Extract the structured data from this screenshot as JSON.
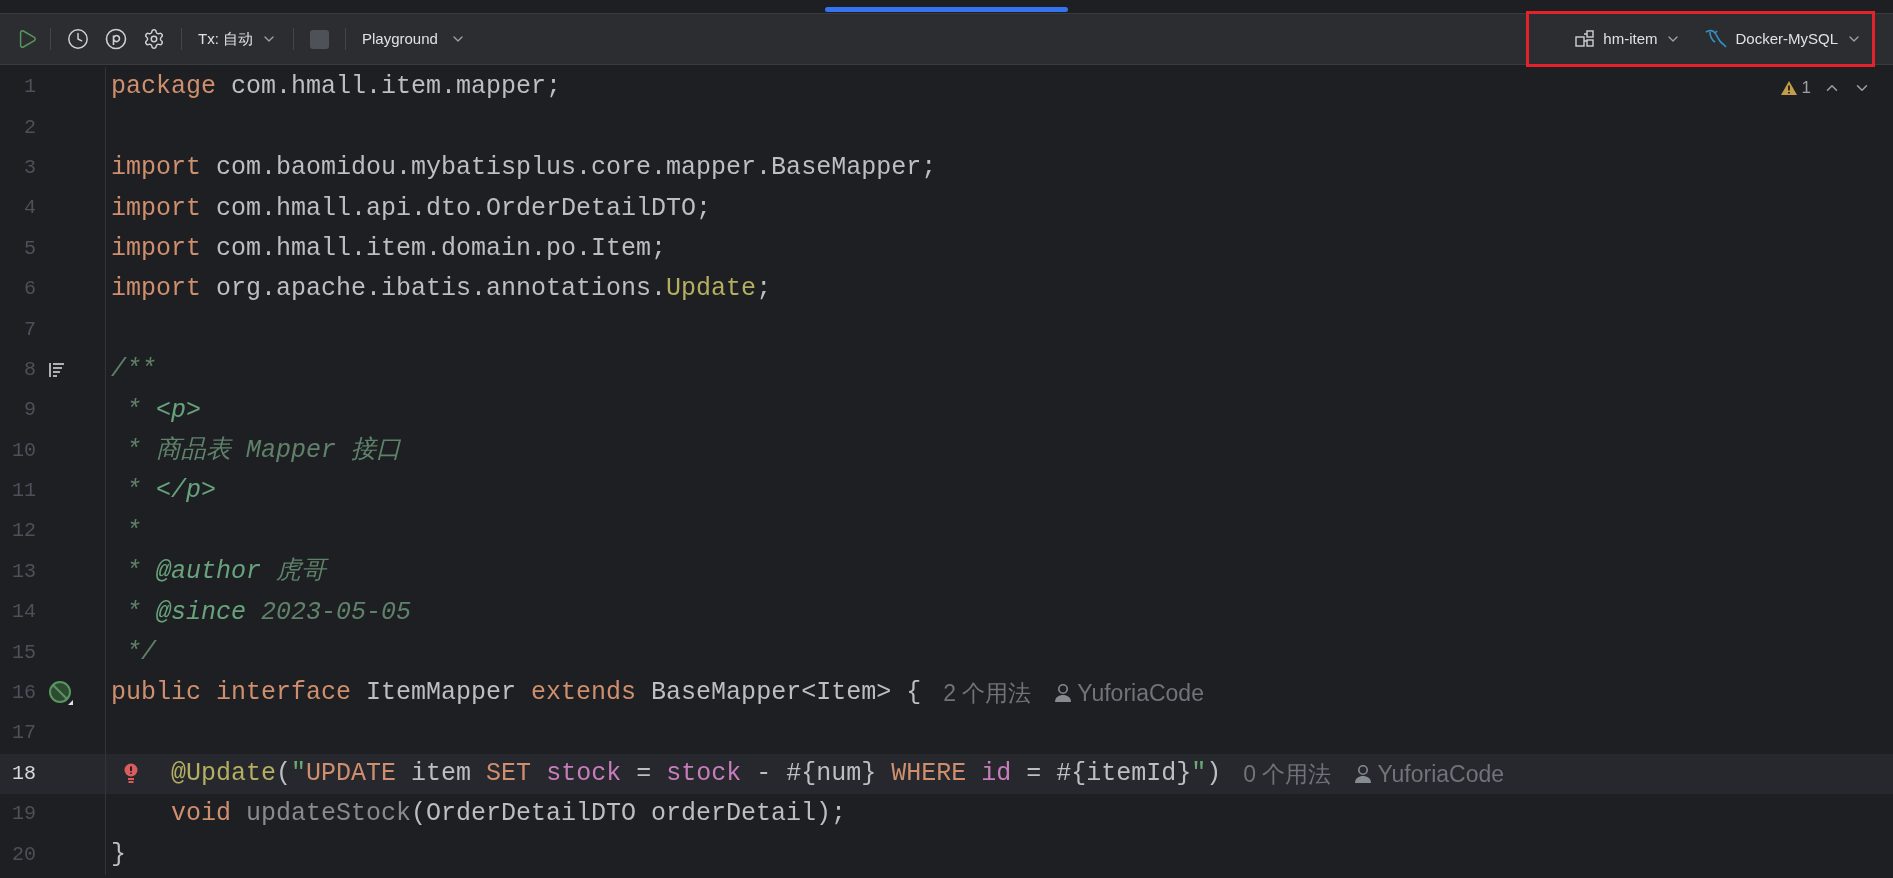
{
  "toolbar": {
    "tx_mode": "Tx: 自动",
    "session": "Playground",
    "schema": "hm-item",
    "datasource": "Docker-MySQL",
    "highlighted": true
  },
  "editor": {
    "problems": "1",
    "lines": [
      {
        "number": "1",
        "kind": "plain",
        "current": false,
        "tokens": [
          {
            "kind": "kw",
            "text": "package "
          },
          {
            "kind": "text",
            "text": "com.hmall.item.mapper;"
          }
        ]
      },
      {
        "number": "2",
        "kind": "plain",
        "current": false
      },
      {
        "number": "3",
        "kind": "plain",
        "current": false,
        "tokens": [
          {
            "kind": "kw",
            "text": "import "
          },
          {
            "kind": "text",
            "text": "com.baomidou.mybatisplus.core.mapper.BaseMapper;"
          }
        ]
      },
      {
        "number": "4",
        "kind": "plain",
        "current": false,
        "tokens": [
          {
            "kind": "kw",
            "text": "import "
          },
          {
            "kind": "text",
            "text": "com.hmall.api.dto.OrderDetailDTO;"
          }
        ]
      },
      {
        "number": "5",
        "kind": "plain",
        "current": false,
        "tokens": [
          {
            "kind": "kw",
            "text": "import "
          },
          {
            "kind": "text",
            "text": "com.hmall.item.domain.po.Item;"
          }
        ]
      },
      {
        "number": "6",
        "kind": "plain",
        "current": false,
        "tokens": [
          {
            "kind": "kw",
            "text": "import "
          },
          {
            "kind": "text",
            "text": "org.apache.ibatis.annotations."
          },
          {
            "kind": "ann",
            "text": "Update"
          },
          {
            "kind": "text",
            "text": ";"
          }
        ]
      },
      {
        "number": "7",
        "kind": "plain",
        "current": false
      },
      {
        "number": "8",
        "kind": "doc",
        "current": false,
        "tokens": [
          {
            "kind": "doc",
            "text": "/**"
          }
        ]
      },
      {
        "number": "9",
        "kind": "plain",
        "current": false,
        "tokens": [
          {
            "kind": "doc",
            "text": " * "
          },
          {
            "kind": "doctag",
            "text": "<p>"
          }
        ]
      },
      {
        "number": "10",
        "kind": "plain",
        "current": false,
        "tokens": [
          {
            "kind": "doc",
            "text": " * 商品表 Mapper 接口"
          }
        ]
      },
      {
        "number": "11",
        "kind": "plain",
        "current": false,
        "tokens": [
          {
            "kind": "doc",
            "text": " * "
          },
          {
            "kind": "doctag",
            "text": "</p>"
          }
        ]
      },
      {
        "number": "12",
        "kind": "plain",
        "current": false,
        "tokens": [
          {
            "kind": "doc",
            "text": " *"
          }
        ]
      },
      {
        "number": "13",
        "kind": "plain",
        "current": false,
        "tokens": [
          {
            "kind": "doc",
            "text": " * "
          },
          {
            "kind": "doctag",
            "text": "@author"
          },
          {
            "kind": "doc",
            "text": " 虎哥"
          }
        ]
      },
      {
        "number": "14",
        "kind": "plain",
        "current": false,
        "tokens": [
          {
            "kind": "doc",
            "text": " * "
          },
          {
            "kind": "doctag",
            "text": "@since"
          },
          {
            "kind": "doc",
            "text": " 2023-05-05"
          }
        ]
      },
      {
        "number": "15",
        "kind": "plain",
        "current": false,
        "tokens": [
          {
            "kind": "doc",
            "text": " */"
          }
        ]
      },
      {
        "number": "16",
        "kind": "implemented",
        "current": false,
        "tokens": [
          {
            "kind": "kw",
            "text": "public interface "
          },
          {
            "kind": "text",
            "text": "ItemMapper "
          },
          {
            "kind": "kw",
            "text": "extends "
          },
          {
            "kind": "text",
            "text": "BaseMapper<Item> {"
          }
        ],
        "usages": "2 个用法",
        "author": "YuforiaCode"
      },
      {
        "number": "17",
        "kind": "plain",
        "current": false
      },
      {
        "number": "18",
        "kind": "warning",
        "current": true,
        "indented": true,
        "tokens": [
          {
            "kind": "ann",
            "text": "@Update"
          },
          {
            "kind": "text",
            "text": "("
          },
          {
            "kind": "str",
            "text": "\""
          },
          {
            "kind": "sql",
            "text": "UPDATE "
          },
          {
            "kind": "text",
            "text": "item "
          },
          {
            "kind": "sql",
            "text": "SET "
          },
          {
            "kind": "col",
            "text": "stock"
          },
          {
            "kind": "text",
            "text": " = "
          },
          {
            "kind": "col",
            "text": "stock"
          },
          {
            "kind": "text",
            "text": " - #{num} "
          },
          {
            "kind": "sql",
            "text": "WHERE "
          },
          {
            "kind": "col",
            "text": "id"
          },
          {
            "kind": "text",
            "text": " = #{itemId}"
          },
          {
            "kind": "str",
            "text": "\""
          },
          {
            "kind": "text",
            "text": ")"
          }
        ],
        "usages": "0 个用法",
        "author": "YuforiaCode"
      },
      {
        "number": "19",
        "kind": "plain",
        "current": false,
        "indented": true,
        "tokens": [
          {
            "kind": "kw",
            "text": "void "
          },
          {
            "kind": "unused",
            "text": "updateStock"
          },
          {
            "kind": "text",
            "text": "(OrderDetailDTO orderDetail);"
          }
        ]
      },
      {
        "number": "20",
        "kind": "plain",
        "current": false,
        "tokens": [
          {
            "kind": "text",
            "text": "}"
          }
        ]
      }
    ]
  }
}
